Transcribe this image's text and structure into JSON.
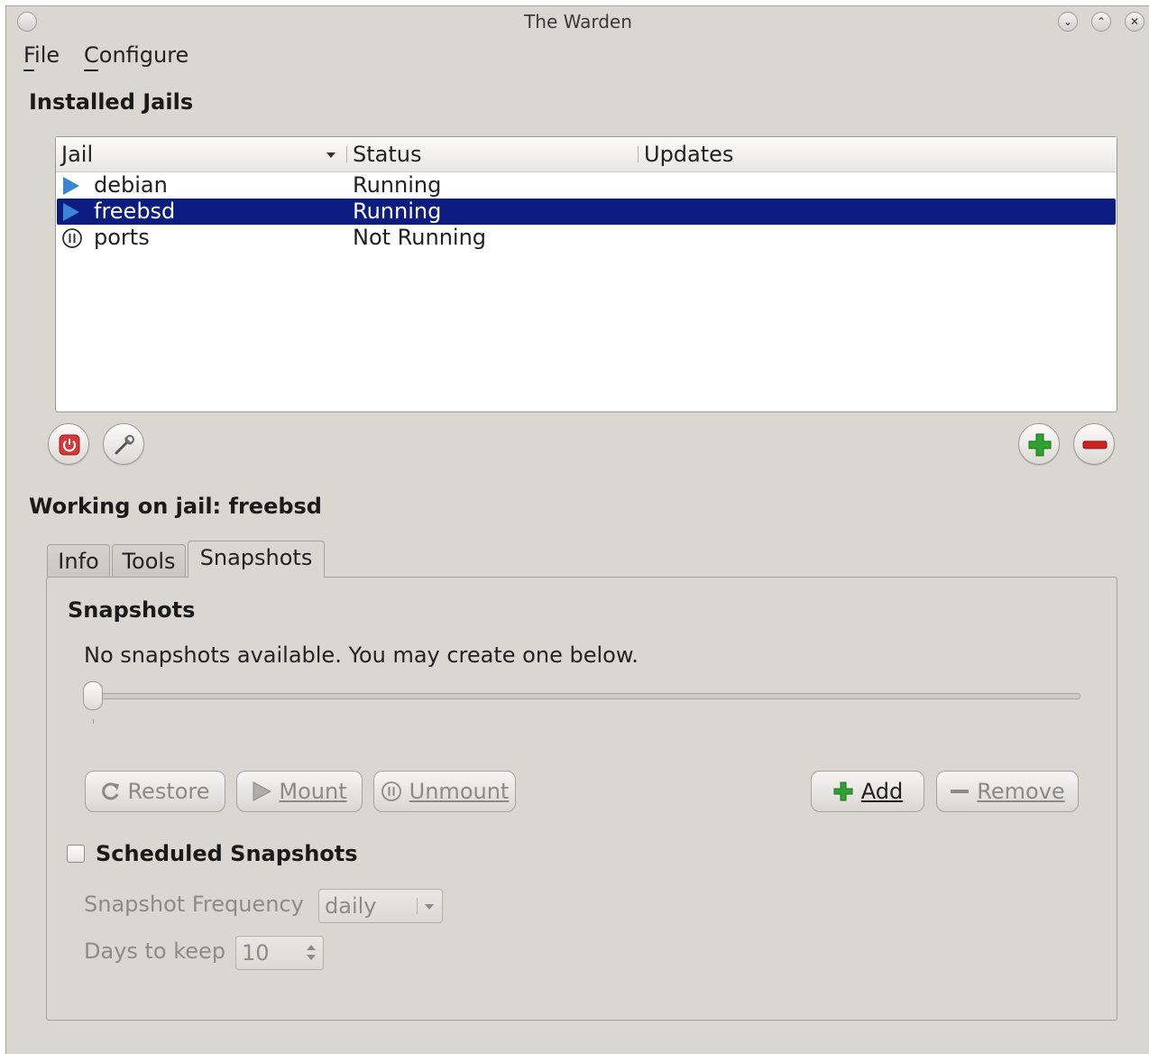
{
  "window": {
    "title": "The Warden"
  },
  "menu": {
    "file": "File",
    "configure": "Configure"
  },
  "installed": {
    "heading": "Installed Jails",
    "columns": {
      "jail": "Jail",
      "status": "Status",
      "updates": "Updates"
    },
    "rows": [
      {
        "name": "debian",
        "status": "Running",
        "icon": "play-icon",
        "selected": false
      },
      {
        "name": "freebsd",
        "status": "Running",
        "icon": "play-icon",
        "selected": true
      },
      {
        "name": "ports",
        "status": "Not Running",
        "icon": "pause-icon",
        "selected": false
      }
    ]
  },
  "working": {
    "heading": "Working on jail: freebsd"
  },
  "tabs": {
    "info": "Info",
    "tools": "Tools",
    "snapshots": "Snapshots",
    "active": "snapshots"
  },
  "snapshots": {
    "heading": "Snapshots",
    "message": "No snapshots available. You may create one below.",
    "restore": "Restore",
    "mount": "Mount",
    "unmount": "Unmount",
    "add": "Add",
    "remove": "Remove",
    "scheduled_label": "Scheduled Snapshots",
    "scheduled_checked": false,
    "frequency_label": "Snapshot Frequency",
    "frequency_value": "daily",
    "days_label": "Days to keep",
    "days_value": "10"
  },
  "colors": {
    "selection": "#0c1c80",
    "accent_blue": "#3b83d6",
    "add_green": "#2ea12e",
    "remove_red": "#cc2222",
    "power_red": "#d33a3a"
  }
}
